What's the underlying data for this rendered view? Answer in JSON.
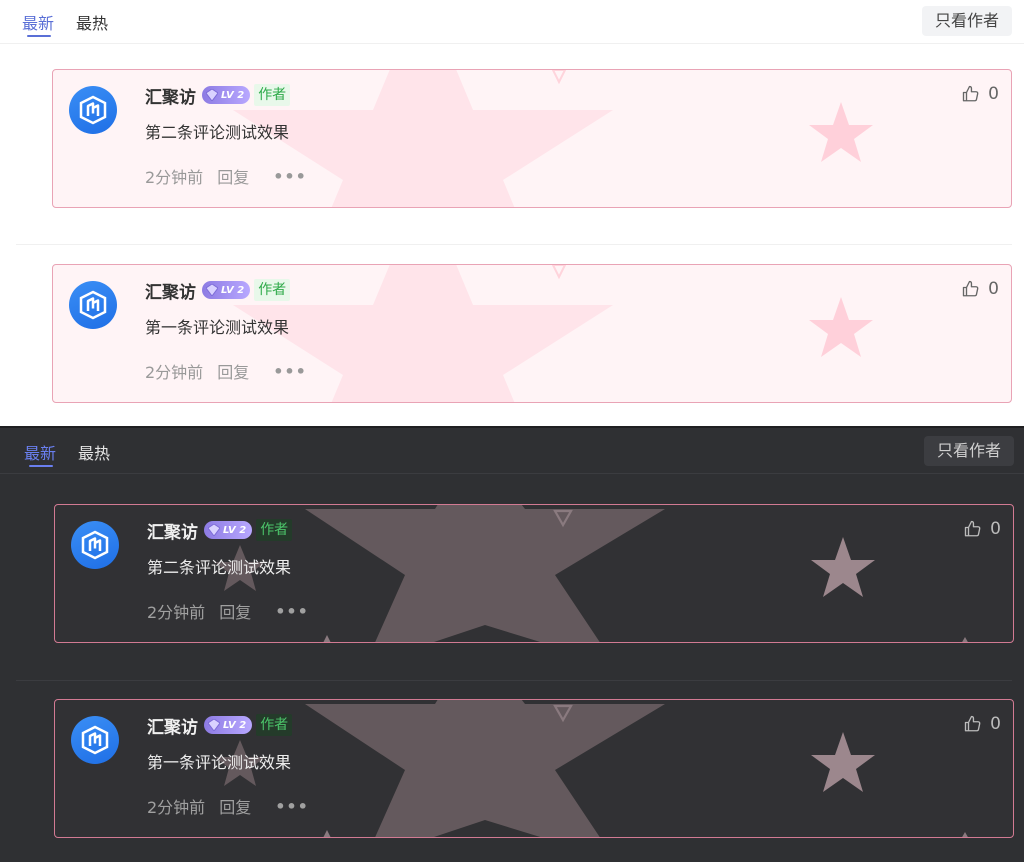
{
  "tabs": {
    "latest": "最新",
    "hottest": "最热"
  },
  "author_only_label": "只看作者",
  "comments": [
    {
      "username": "汇聚访",
      "level": "LV 2",
      "author_tag": "作者",
      "content": "第二条评论测试效果",
      "time": "2分钟前",
      "reply": "回复",
      "more": "•••",
      "likes": "0"
    },
    {
      "username": "汇聚访",
      "level": "LV 2",
      "author_tag": "作者",
      "content": "第一条评论测试效果",
      "time": "2分钟前",
      "reply": "回复",
      "more": "•••",
      "likes": "0"
    }
  ],
  "colors": {
    "accent": "#5a6fd6",
    "light_card_bg": "#fff4f6",
    "light_card_border": "#e9a3b5",
    "dark_bg": "#2f3033",
    "dark_card_border": "#d27a93",
    "author_tag_green": "#2faa4a",
    "avatar_blue": "#2a7ff0"
  },
  "icons": {
    "like": "thumbs-up-icon",
    "avatar": "cube-logo-icon",
    "level": "gem-icon",
    "more": "more-dots-icon"
  }
}
